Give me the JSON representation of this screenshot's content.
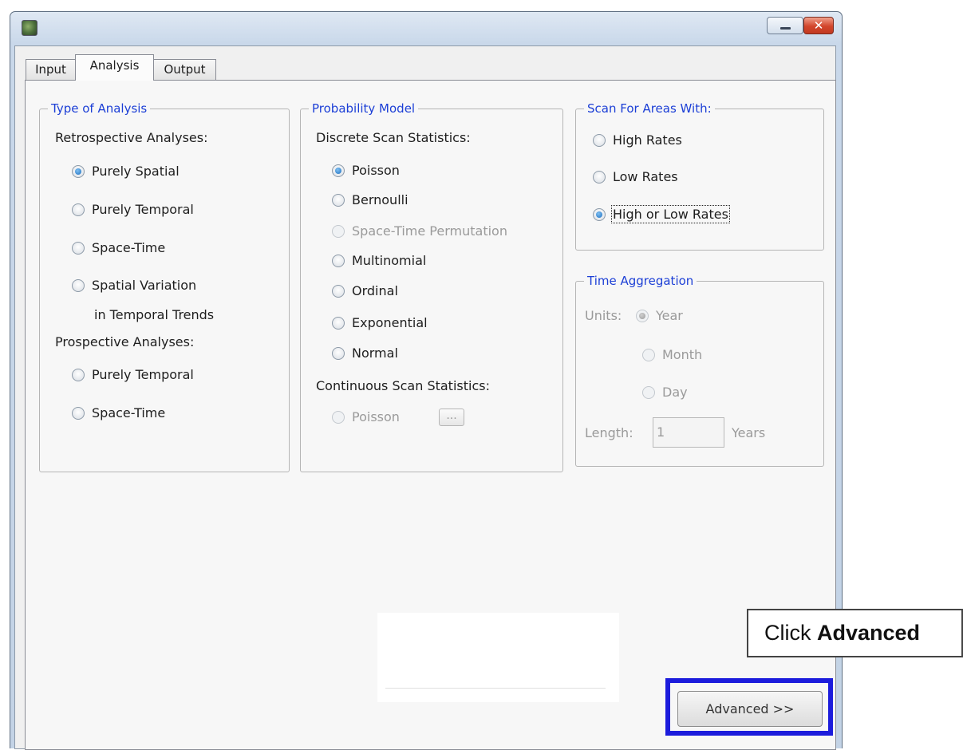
{
  "window": {
    "icon": "app-icon",
    "controls": {
      "minimize_icon": "minimize-icon",
      "close_glyph": "✕"
    }
  },
  "tabs": [
    {
      "label": "Input",
      "selected": false
    },
    {
      "label": "Analysis",
      "selected": true
    },
    {
      "label": "Output",
      "selected": false
    }
  ],
  "type_of_analysis": {
    "legend": "Type of Analysis",
    "retrospective_heading": "Retrospective Analyses:",
    "retrospective_options": [
      "Purely Spatial",
      "Purely Temporal",
      "Space-Time",
      "Spatial Variation",
      "in Temporal Trends"
    ],
    "prospective_heading": "Prospective Analyses:",
    "prospective_options": [
      "Purely Temporal",
      "Space-Time"
    ],
    "selected": "Purely Spatial"
  },
  "probability_model": {
    "legend": "Probability Model",
    "discrete_heading": "Discrete Scan Statistics:",
    "discrete_options": [
      "Poisson",
      "Bernoulli",
      "Space-Time Permutation",
      "Multinomial",
      "Ordinal",
      "Exponential",
      "Normal"
    ],
    "continuous_heading": "Continuous Scan Statistics:",
    "continuous_options": [
      "Poisson"
    ],
    "continuous_button": "...",
    "selected": "Poisson",
    "disabled": [
      "Space-Time Permutation",
      "Continuous Poisson"
    ]
  },
  "scan_for_areas": {
    "legend": "Scan For Areas With:",
    "options": [
      "High Rates",
      "Low Rates",
      "High or Low Rates"
    ],
    "selected": "High or Low Rates"
  },
  "time_aggregation": {
    "legend": "Time Aggregation",
    "units_label": "Units:",
    "units": [
      "Year",
      "Month",
      "Day"
    ],
    "selected_unit": "Year",
    "length_label": "Length:",
    "length_value": "1",
    "length_units": "Years"
  },
  "buttons": {
    "advanced": "Advanced >>"
  },
  "callout": {
    "prefix": "Click ",
    "bold": "Advanced"
  },
  "colors": {
    "legend_text": "#1c3fd6",
    "highlight": "#1c1cdc",
    "close_button": "#d2462c"
  }
}
